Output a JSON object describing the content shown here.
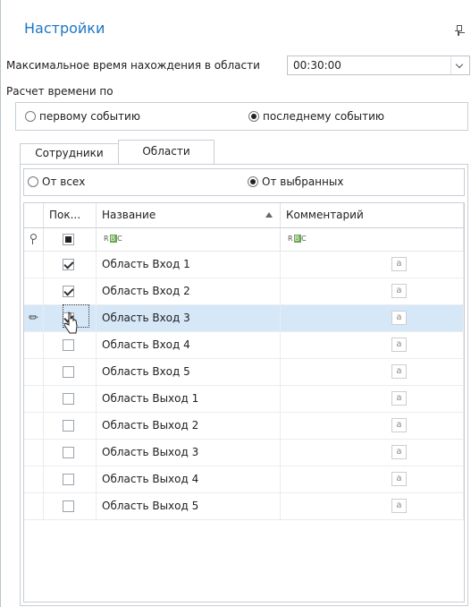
{
  "panel": {
    "title": "Настройки"
  },
  "max_time": {
    "label": "Максимальное время нахождения в области",
    "value": "00:30:00"
  },
  "calc": {
    "label": "Расчет времени по",
    "options": [
      {
        "label": "первому событию",
        "selected": false
      },
      {
        "label": "последнему событию",
        "selected": true
      }
    ]
  },
  "tabs": [
    {
      "label": "Сотрудники",
      "active": false
    },
    {
      "label": "Области",
      "active": true
    }
  ],
  "scope": {
    "options": [
      {
        "label": "От всех",
        "selected": false
      },
      {
        "label": "От выбранных",
        "selected": true
      }
    ]
  },
  "grid": {
    "columns": [
      "Пок...",
      "Название",
      "Комментарий"
    ],
    "sort_column": "Название",
    "sort_direction": "ascending",
    "filter_icon": "text-filter-icon",
    "filter_text_glyph": "R B C",
    "comment_button_glyph": "a",
    "rows": [
      {
        "checked": true,
        "name": "Область Вход 1",
        "selected": false
      },
      {
        "checked": true,
        "name": "Область Вход 2",
        "selected": false
      },
      {
        "checked": true,
        "name": "Область Вход 3",
        "selected": true
      },
      {
        "checked": false,
        "name": "Область Вход 4",
        "selected": false
      },
      {
        "checked": false,
        "name": "Область Вход 5",
        "selected": false
      },
      {
        "checked": false,
        "name": "Область Выход 1",
        "selected": false
      },
      {
        "checked": false,
        "name": "Область Выход 2",
        "selected": false
      },
      {
        "checked": false,
        "name": "Область Выход 3",
        "selected": false
      },
      {
        "checked": false,
        "name": "Область Выход 4",
        "selected": false
      },
      {
        "checked": false,
        "name": "Область Выход 5",
        "selected": false
      }
    ]
  },
  "colors": {
    "title": "#1d76c3",
    "selected_row": "#d6e8f8",
    "border": "#c9ced4"
  }
}
